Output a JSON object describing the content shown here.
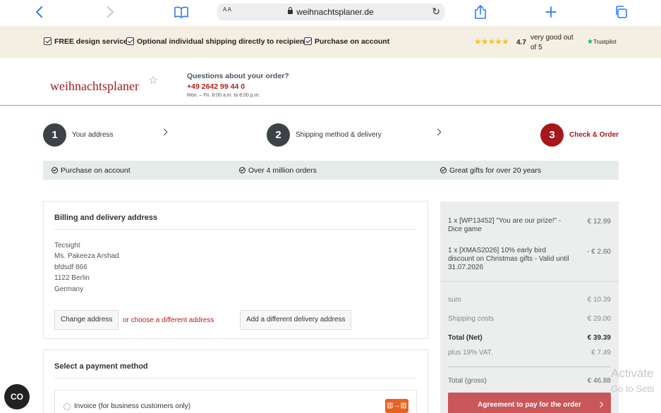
{
  "browser": {
    "url": "weihnachtsplaner.de",
    "text_size_label": "A A",
    "icons": [
      "back-icon",
      "forward-icon",
      "bookmarks-icon",
      "lock-icon",
      "reload-icon",
      "share-icon",
      "new-tab-icon",
      "tabs-icon"
    ]
  },
  "promo": {
    "items": [
      "FREE design service",
      "Optional individual shipping directly to recipient",
      "Purchase on account"
    ],
    "stars": "★★★★★",
    "rating": "4.7",
    "rating_text": "very good out of 5",
    "trustpilot": "Trustpilot",
    "star_color": "#f5c518"
  },
  "header": {
    "logo": "weihnachtsplaner",
    "question": "Questions about your order?",
    "phone": "+49 2642 99 44 0",
    "hours": "Mon. – Fri. 8:00 a.m. to 6:00 p.m."
  },
  "steps": [
    {
      "number": "1",
      "label": "Your address"
    },
    {
      "number": "2",
      "label": "Shipping method & delivery"
    },
    {
      "number": "3",
      "label": "Check & Order"
    }
  ],
  "benefits": [
    "Purchase on account",
    "Over 4 million orders",
    "Great gifts for over 20 years"
  ],
  "address": {
    "title": "Billing and delivery address",
    "lines": [
      "Tecsight",
      "Ms. Pakeeza Arshad",
      "bfdsdf 866",
      "1122 Berlin",
      "Germany"
    ],
    "change_button": "Change address",
    "or_link": "or choose a different address",
    "add_button": "Add a different delivery address"
  },
  "payment": {
    "title": "Select a payment method",
    "option": "Invoice (for business customers only)"
  },
  "summary": {
    "items": [
      {
        "desc": "1 x [WP13452] \"You are our prize!\" - Dice game",
        "price": "€ 12.99"
      },
      {
        "desc": "1 x [XMAS2026] 10% early bird discount on Christmas gifts - Valid until 31.07.2026",
        "price": "- € 2.60"
      }
    ],
    "sum_label": "sum",
    "sum_value": "€ 10.39",
    "shipping_label": "Shipping costs",
    "shipping_value": "€ 29.00",
    "net_label": "Total (Net)",
    "net_value": "€ 39.39",
    "vat_label": "plus 19% VAT.",
    "vat_value": "€ 7.49",
    "gross_label": "Total (gross)",
    "gross_value": "€ 46.88",
    "pay_button": "Agreement to pay for the order"
  },
  "overlay": {
    "activate": "Activate",
    "go_to_settings": "Go to Setti"
  },
  "chat": {
    "label": "CO"
  },
  "colors": {
    "accent": "#a8171b",
    "promo_bg": "#f4efe2",
    "benefit_bg": "#e6ecea",
    "pay_button": "#c9575a"
  }
}
